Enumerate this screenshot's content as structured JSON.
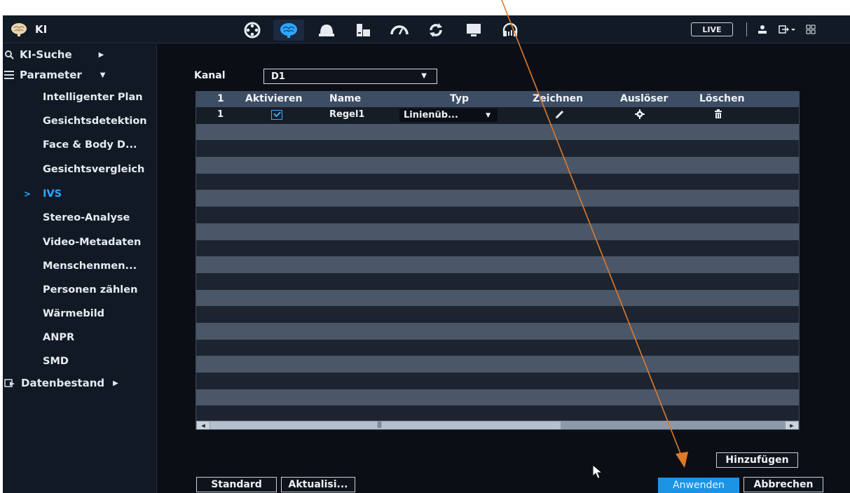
{
  "app": {
    "title": "KI"
  },
  "colors": {
    "accent": "#2fa7ff",
    "primary_button": "#1b94e6",
    "annotation_arrow": "#e07a2a"
  },
  "toolbar": {
    "icons": [
      "film-reel-icon",
      "brain-icon",
      "dome-camera-icon",
      "storage-icon",
      "speedometer-icon",
      "sync-icon",
      "monitor-icon",
      "headset-icon"
    ],
    "live_label": "LIVE",
    "right_icons": [
      "user-icon",
      "logout-icon",
      "grid-menu-icon"
    ]
  },
  "sidebar": {
    "search": "KI-Suche",
    "parameter": "Parameter",
    "items": [
      "Intelligenter Plan",
      "Gesichtsdetektion",
      "Face & Body D...",
      "Gesichtsvergleich",
      "IVS",
      "Stereo-Analyse",
      "Video-Metadaten",
      "Menschenmen...",
      "Personen zählen",
      "Wärmebild",
      "ANPR",
      "SMD"
    ],
    "active_item": "IVS",
    "database": "Datenbestand"
  },
  "channel": {
    "label": "Kanal",
    "value": "D1"
  },
  "table": {
    "columns": [
      "1",
      "Aktivieren",
      "Name",
      "Typ",
      "Zeichnen",
      "Auslöser",
      "Löschen"
    ],
    "rows": [
      {
        "index": "1",
        "enabled": true,
        "name": "Regel1",
        "type": "Linienüb...",
        "draw_icon": "pencil-icon",
        "trigger_icon": "gear-icon",
        "delete_icon": "trash-icon"
      }
    ]
  },
  "buttons": {
    "add": "Hinzufügen",
    "default": "Standard",
    "refresh": "Aktualisi...",
    "apply": "Anwenden",
    "cancel": "Abbrechen"
  }
}
